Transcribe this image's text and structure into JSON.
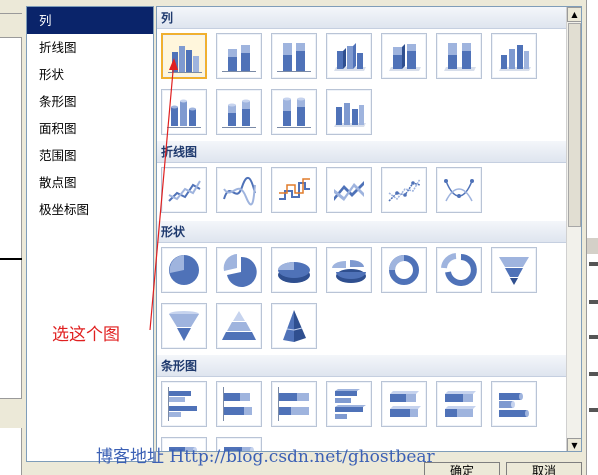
{
  "chart_types": [
    {
      "label": "列",
      "selected": true
    },
    {
      "label": "折线图",
      "selected": false
    },
    {
      "label": "形状",
      "selected": false
    },
    {
      "label": "条形图",
      "selected": false
    },
    {
      "label": "面积图",
      "selected": false
    },
    {
      "label": "范围图",
      "selected": false
    },
    {
      "label": "散点图",
      "selected": false
    },
    {
      "label": "极坐标图",
      "selected": false
    }
  ],
  "gallery": {
    "sections": [
      {
        "title": "列",
        "icon_names": [
          "clustered-column-icon",
          "stacked-column-icon",
          "100-stacked-column-icon",
          "3d-clustered-column-icon",
          "3d-stacked-column-icon",
          "3d-100-stacked-column-icon",
          "3d-column-icon",
          "cylinder-column-icon",
          "cylinder-stacked-column-icon",
          "cylinder-100-stacked-column-icon",
          "cylinder-3d-column-icon"
        ]
      },
      {
        "title": "折线图",
        "icon_names": [
          "line-icon",
          "smooth-line-icon",
          "step-line-icon",
          "3d-line-icon",
          "line-with-markers-icon",
          "smooth-line-with-markers-icon"
        ]
      },
      {
        "title": "形状",
        "icon_names": [
          "pie-icon",
          "exploded-pie-icon",
          "3d-pie-icon",
          "3d-exploded-pie-icon",
          "doughnut-icon",
          "exploded-doughnut-icon",
          "funnel-icon",
          "cone-funnel-icon",
          "pyramid-icon",
          "3d-pyramid-icon"
        ]
      },
      {
        "title": "条形图",
        "icon_names": [
          "clustered-bar-icon",
          "stacked-bar-icon",
          "100-stacked-bar-icon",
          "3d-clustered-bar-icon",
          "3d-stacked-bar-icon",
          "3d-100-stacked-bar-icon",
          "cylinder-bar-icon",
          "cylinder-stacked-bar-icon"
        ]
      }
    ]
  },
  "annotation": {
    "text": "选这个图",
    "color": "#e02020"
  },
  "watermark": {
    "text": "博客地址 Http://blog.csdn.net/ghostbear",
    "color": "#3b60b5"
  },
  "buttons": {
    "ok": "确定",
    "cancel": "取消"
  },
  "colors": {
    "selection": "#0a246a",
    "thumb_selected_border": "#f0b030",
    "section_text": "#1f3a6e",
    "icon_blue": "#4f72b8"
  }
}
